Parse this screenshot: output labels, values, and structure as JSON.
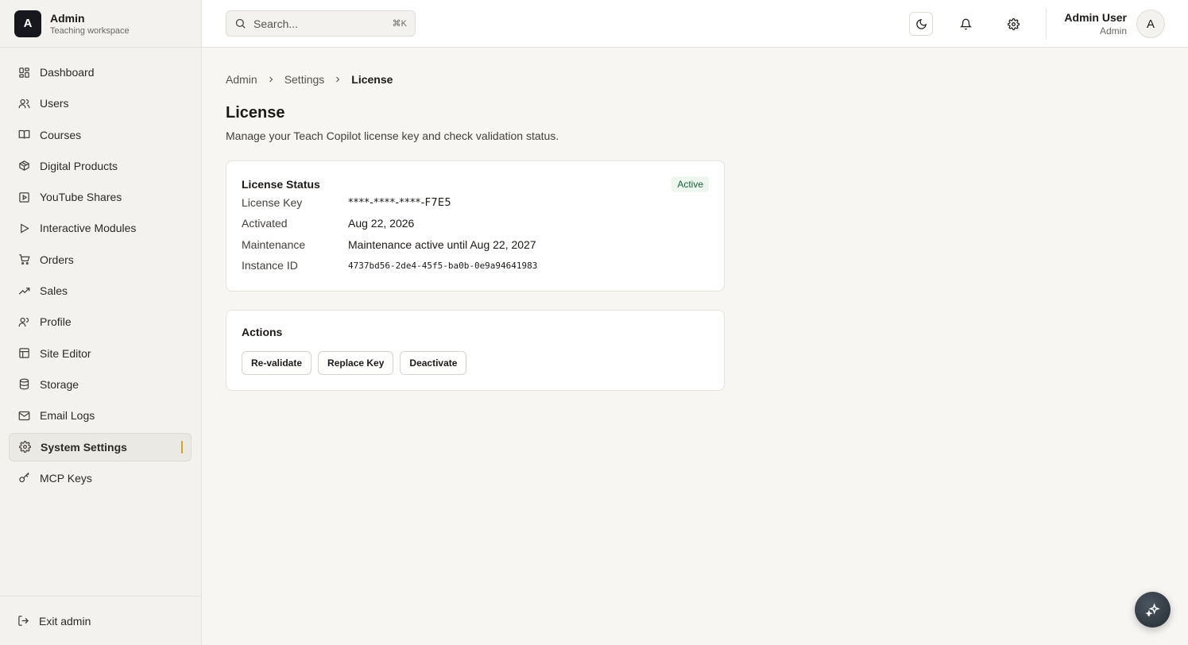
{
  "brand": {
    "logo_letter": "A",
    "title": "Admin",
    "subtitle": "Teaching workspace"
  },
  "sidebar": {
    "items": [
      {
        "label": "Dashboard",
        "icon": "dashboard-icon"
      },
      {
        "label": "Users",
        "icon": "users-icon"
      },
      {
        "label": "Courses",
        "icon": "book-icon"
      },
      {
        "label": "Digital Products",
        "icon": "package-icon"
      },
      {
        "label": "YouTube Shares",
        "icon": "video-icon"
      },
      {
        "label": "Interactive Modules",
        "icon": "play-icon"
      },
      {
        "label": "Orders",
        "icon": "cart-icon"
      },
      {
        "label": "Sales",
        "icon": "trending-up-icon"
      },
      {
        "label": "Profile",
        "icon": "profile-icon"
      },
      {
        "label": "Site Editor",
        "icon": "layout-icon"
      },
      {
        "label": "Storage",
        "icon": "database-icon"
      },
      {
        "label": "Email Logs",
        "icon": "mail-icon"
      },
      {
        "label": "System Settings",
        "icon": "gear-icon",
        "active": true
      },
      {
        "label": "MCP Keys",
        "icon": "key-icon"
      }
    ],
    "footer_label": "Exit admin"
  },
  "topbar": {
    "search_placeholder": "Search...",
    "search_shortcut": "⌘K",
    "user_name": "Admin User",
    "user_role": "Admin",
    "avatar_letter": "A"
  },
  "breadcrumb": [
    "Admin",
    "Settings",
    "License"
  ],
  "page": {
    "title": "License",
    "description": "Manage your Teach Copilot license key and check validation status."
  },
  "license_card": {
    "title": "License Status",
    "status_badge": "Active",
    "status_color": "#166534",
    "rows": [
      {
        "label": "License Key",
        "value": "****-****-****-F7E5"
      },
      {
        "label": "Activated",
        "value": "Aug 22, 2026"
      },
      {
        "label": "Maintenance",
        "value": "Maintenance active until Aug 22, 2027"
      },
      {
        "label": "Instance ID",
        "value": "4737bd56-2de4-45f5-ba0b-0e9a94641983"
      }
    ]
  },
  "actions_card": {
    "title": "Actions",
    "buttons": [
      "Re-validate",
      "Replace Key",
      "Deactivate"
    ]
  },
  "accent_color": "#d69e2e"
}
